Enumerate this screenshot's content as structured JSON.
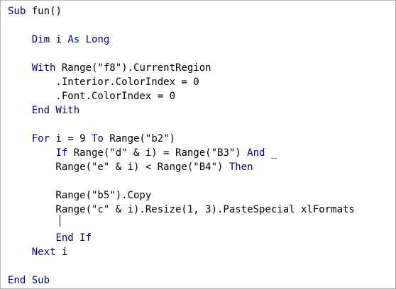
{
  "editor": {
    "language": "vba",
    "keyword_color": "#00008B",
    "text_color": "#000000",
    "lines": [
      [
        {
          "t": "Sub",
          "k": true
        },
        {
          "t": " fun()"
        }
      ],
      [],
      [
        {
          "t": "    "
        },
        {
          "t": "Dim",
          "k": true
        },
        {
          "t": " i "
        },
        {
          "t": "As",
          "k": true
        },
        {
          "t": " "
        },
        {
          "t": "Long",
          "k": true
        }
      ],
      [],
      [
        {
          "t": "    "
        },
        {
          "t": "With",
          "k": true
        },
        {
          "t": " Range(\"f8\").CurrentRegion"
        }
      ],
      [
        {
          "t": "        .Interior.ColorIndex = 0"
        }
      ],
      [
        {
          "t": "        .Font.ColorIndex = 0"
        }
      ],
      [
        {
          "t": "    "
        },
        {
          "t": "End With",
          "k": true
        }
      ],
      [],
      [
        {
          "t": "    "
        },
        {
          "t": "For",
          "k": true
        },
        {
          "t": " i = 9 "
        },
        {
          "t": "To",
          "k": true
        },
        {
          "t": " Range(\"b2\")"
        }
      ],
      [
        {
          "t": "        "
        },
        {
          "t": "If",
          "k": true
        },
        {
          "t": " Range(\"d\" & i) = Range(\"B3\") "
        },
        {
          "t": "And",
          "k": true
        },
        {
          "t": " _"
        }
      ],
      [
        {
          "t": "        Range(\"e\" & i) < Range(\"B4\") "
        },
        {
          "t": "Then",
          "k": true
        }
      ],
      [],
      [
        {
          "t": "        Range(\"b5\").Copy"
        }
      ],
      [
        {
          "t": "        Range(\"c\" & i).Resize(1, 3).PasteSpecial xlFormats"
        }
      ],
      [],
      [
        {
          "t": "        "
        },
        {
          "t": "End If",
          "k": true
        }
      ],
      [
        {
          "t": "    "
        },
        {
          "t": "Next",
          "k": true
        },
        {
          "t": " i"
        }
      ],
      [],
      [
        {
          "t": "End Sub",
          "k": true
        }
      ]
    ]
  }
}
